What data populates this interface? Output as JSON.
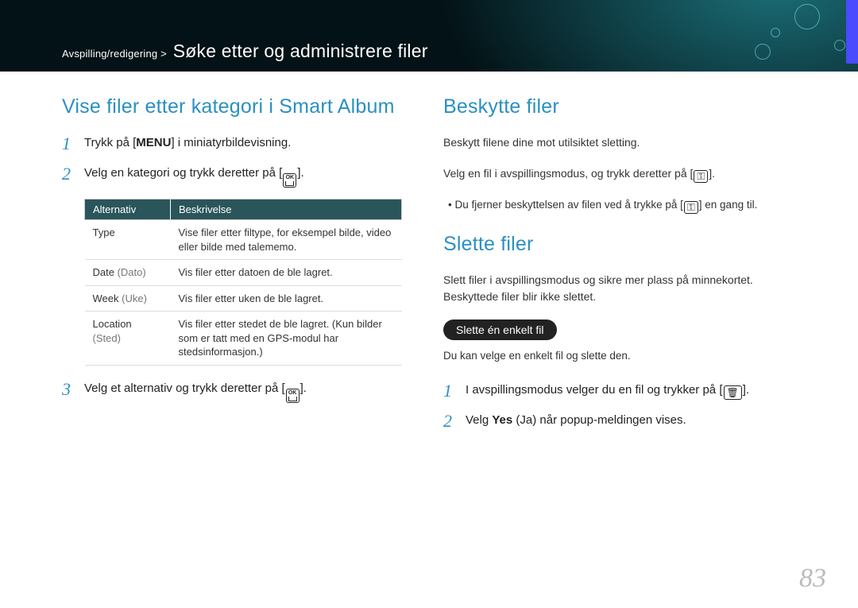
{
  "breadcrumb": {
    "prefix": "Avspilling/redigering >",
    "main": "Søke etter og administrere filer"
  },
  "page_number": "83",
  "left": {
    "heading": "Vise filer etter kategori i Smart Album",
    "step1": {
      "before": "Trykk på [",
      "bold": "MENU",
      "after": "] i miniatyrbildevisning."
    },
    "step2": "Velg en kategori og trykk deretter på [",
    "step2_end": "].",
    "table": {
      "head_alt": "Alternativ",
      "head_desc": "Beskrivelse",
      "rows": [
        {
          "alt": "Type",
          "desc": "Vise filer etter filtype, for eksempel bilde, video eller bilde med talememo."
        },
        {
          "alt": "Date",
          "alt_paren": "(Dato)",
          "desc": "Vis filer etter datoen de ble lagret."
        },
        {
          "alt": "Week",
          "alt_paren": "(Uke)",
          "desc": "Vis filer etter uken de ble lagret."
        },
        {
          "alt": "Location",
          "alt_paren": "(Sted)",
          "desc": "Vis filer etter stedet de ble lagret. (Kun bilder som er tatt med en GPS-modul har stedsinformasjon.)"
        }
      ]
    },
    "step3": "Velg et alternativ og trykk deretter på [",
    "step3_end": "]."
  },
  "right": {
    "protect_heading": "Beskytte filer",
    "protect_body": "Beskytt filene dine mot utilsiktet sletting.",
    "protect_step": "Velg en fil i avspillingsmodus, og trykk deretter på [",
    "protect_step_end": "].",
    "protect_bullet": "Du fjerner beskyttelsen av filen ved å trykke på [",
    "protect_bullet_end": "] en gang til.",
    "delete_heading": "Slette filer",
    "delete_body": "Slett filer i avspillingsmodus og sikre mer plass på minnekortet. Beskyttede filer blir ikke slettet.",
    "delete_pill": "Slette én enkelt fil",
    "delete_sub": "Du kan velge en enkelt fil og slette den.",
    "delete_step1": "I avspillingsmodus velger du en fil og trykker på [",
    "delete_step1_end": "].",
    "delete_step2_before": "Velg ",
    "delete_step2_bold": "Yes",
    "delete_step2_after": " (Ja) når popup-meldingen vises."
  }
}
